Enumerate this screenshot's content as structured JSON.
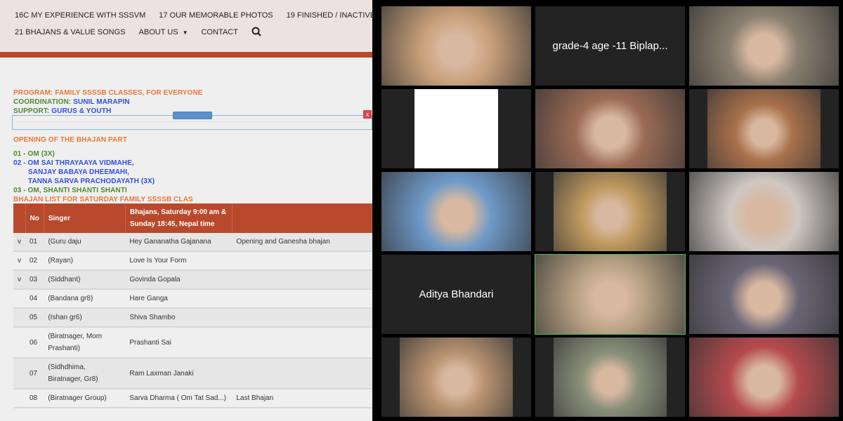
{
  "website": {
    "nav": {
      "row1": [
        "16C MY EXPERIENCE WITH SSSVM",
        "17 OUR MEMORABLE PHOTOS",
        "19 FINISHED / INACTIVE"
      ],
      "row2": [
        "21 BHAJANS & VALUE SONGS",
        "ABOUT US",
        "CONTACT"
      ],
      "search_icon": "search-icon"
    },
    "program_label": "PROGRAM: FAMILY SSSSB CLASSES, FOR EVERYONE",
    "coordination_label": "COORDINATION: ",
    "coordination_value": "SUNIL MARAPIN",
    "support_label": "SUPPORT: ",
    "support_value": "GURUS & YOUTH",
    "close_label": "x",
    "opening_title": "OPENING OF THE BHAJAN PART",
    "opening": {
      "l1": "01 - OM (3X)",
      "l2": "02 - OM SAI THRAYAAYA VIDMAHE,",
      "l3": "SANJAY BABAYA DHEEMAHI,",
      "l4": "TANNA SARVA PRACHODAYATH (3X)",
      "l5": "03 - OM, SHANTI SHANTI SHANTI"
    },
    "list_title": "BHAJAN LIST FOR SATURDAY FAMILY SSSSB CLAS",
    "table": {
      "headers": {
        "no": "No",
        "singer": "Singer",
        "bhajans": "Bhajans, Saturday 9:00 am & Sunday 18:45, Nepal time"
      },
      "rows": [
        {
          "mark": "v",
          "no": "01",
          "singer": "(Guru daju",
          "bhajan": "Hey Gananatha Gajanana",
          "note": "Opening and Ganesha bhajan"
        },
        {
          "mark": "v",
          "no": "02",
          "singer": "(Rayan)",
          "bhajan": "Love Is Your Form",
          "note": ""
        },
        {
          "mark": "v",
          "no": "03",
          "singer": "(Siddhant)",
          "bhajan": "Govinda Gopala",
          "note": ""
        },
        {
          "mark": "",
          "no": "04",
          "singer": "(Bandana gr8)",
          "bhajan": "Hare Ganga",
          "note": ""
        },
        {
          "mark": "",
          "no": "05",
          "singer": "(Ishan gr6)",
          "bhajan": "Shiva Shambo",
          "note": ""
        },
        {
          "mark": "",
          "no": "06",
          "singer": "(Biratnager, Mom Prashanti)",
          "bhajan": "Prashanti Sai",
          "note": ""
        },
        {
          "mark": "",
          "no": "07",
          "singer": "(Sidhdhima, Biratnager, Gr8)",
          "bhajan": "Ram Laxman Janaki",
          "note": ""
        },
        {
          "mark": "",
          "no": "08",
          "singer": "(Biratnager Group)",
          "bhajan": "Sarva Dharma ( Om Tat Sad...)",
          "note": "Last Bhajan"
        }
      ]
    }
  },
  "meeting": {
    "tiles": [
      {
        "name": "",
        "bg": "#c9a07a"
      },
      {
        "name": "grade-4 age -11  Biplap...",
        "bg": ""
      },
      {
        "name": "",
        "bg": "#8a7f70"
      },
      {
        "name": "",
        "bg": "#ffffff"
      },
      {
        "name": "",
        "bg": "#9b6b55"
      },
      {
        "name": "",
        "bg": "#a9714c"
      },
      {
        "name": "",
        "bg": "#6f9ac9"
      },
      {
        "name": "",
        "bg": "#c09a60"
      },
      {
        "name": "",
        "bg": "#cfc7c2"
      },
      {
        "name": "Aditya Bhandari",
        "bg": ""
      },
      {
        "name": "",
        "bg": "#b8a284",
        "active": true
      },
      {
        "name": "",
        "bg": "#6b6676"
      },
      {
        "name": "",
        "bg": "#b89270"
      },
      {
        "name": "",
        "bg": "#8a8f7a"
      },
      {
        "name": "",
        "bg": "#b54a4e"
      }
    ],
    "active_speaker_color": "#4cc04c"
  }
}
